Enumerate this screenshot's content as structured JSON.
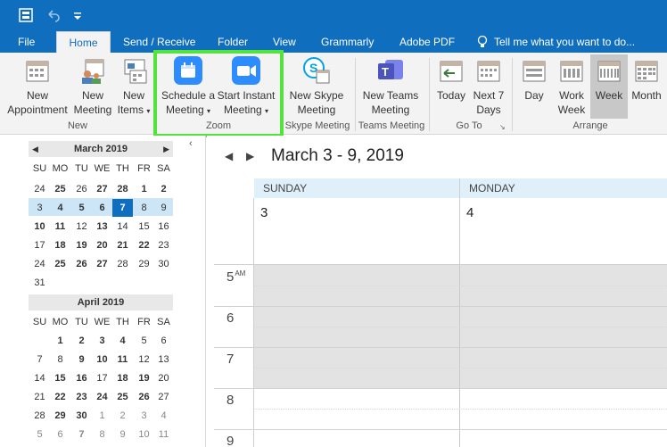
{
  "titlebar": {
    "icons": [
      "app-menu-icon",
      "undo-icon",
      "customize-icon"
    ]
  },
  "tabs": [
    "File",
    "Home",
    "Send / Receive",
    "Folder",
    "View",
    "Grammarly",
    "Adobe PDF"
  ],
  "tell_me": "Tell me what you want to do...",
  "ribbon": {
    "new_appointment": "New Appointment",
    "new_appointment_l1": "New",
    "new_appointment_l2": "Appointment",
    "new_meeting_l1": "New",
    "new_meeting_l2": "Meeting",
    "new_items_l1": "New",
    "new_items_l2": "Items",
    "group_new": "New",
    "schedule_l1": "Schedule a",
    "schedule_l2": "Meeting",
    "start_l1": "Start Instant",
    "start_l2": "Meeting",
    "group_zoom": "Zoom",
    "skype_l1": "New Skype",
    "skype_l2": "Meeting",
    "group_skype": "Skype Meeting",
    "teams_l1": "New Teams",
    "teams_l2": "Meeting",
    "group_teams": "Teams Meeting",
    "today": "Today",
    "next7_l1": "Next 7",
    "next7_l2": "Days",
    "group_goto": "Go To",
    "day": "Day",
    "workweek_l1": "Work",
    "workweek_l2": "Week",
    "week": "Week",
    "month": "Month",
    "group_arrange": "Arrange"
  },
  "calendar": {
    "march_title": "March 2019",
    "april_title": "April 2019",
    "dow": [
      "SU",
      "MO",
      "TU",
      "WE",
      "TH",
      "FR",
      "SA"
    ],
    "march_weeks": [
      [
        "24",
        "25",
        "26",
        "27",
        "28",
        "1",
        "2"
      ],
      [
        "3",
        "4",
        "5",
        "6",
        "7",
        "8",
        "9"
      ],
      [
        "10",
        "11",
        "12",
        "13",
        "14",
        "15",
        "16"
      ],
      [
        "17",
        "18",
        "19",
        "20",
        "21",
        "22",
        "23"
      ],
      [
        "24",
        "25",
        "26",
        "27",
        "28",
        "29",
        "30"
      ],
      [
        "31"
      ]
    ],
    "april_weeks": [
      [
        "",
        "1",
        "2",
        "3",
        "4",
        "5",
        "6"
      ],
      [
        "7",
        "8",
        "9",
        "10",
        "11",
        "12",
        "13"
      ],
      [
        "14",
        "15",
        "16",
        "17",
        "18",
        "19",
        "20"
      ],
      [
        "21",
        "22",
        "23",
        "24",
        "25",
        "26",
        "27"
      ],
      [
        "28",
        "29",
        "30",
        "1",
        "2",
        "3",
        "4"
      ],
      [
        "5",
        "6",
        "7",
        "8",
        "9",
        "10",
        "11"
      ]
    ]
  },
  "main": {
    "range": "March 3 - 9, 2019",
    "days": [
      {
        "name": "SUNDAY",
        "num": "3"
      },
      {
        "name": "MONDAY",
        "num": "4"
      }
    ],
    "hours": [
      {
        "h": "5",
        "ampm": "AM"
      },
      {
        "h": "6",
        "ampm": ""
      },
      {
        "h": "7",
        "ampm": ""
      },
      {
        "h": "8",
        "ampm": ""
      },
      {
        "h": "9",
        "ampm": ""
      }
    ]
  },
  "colors": {
    "accent": "#106ebe",
    "highlight": "#52e33d",
    "zoom_blue": "#2d8cff"
  }
}
